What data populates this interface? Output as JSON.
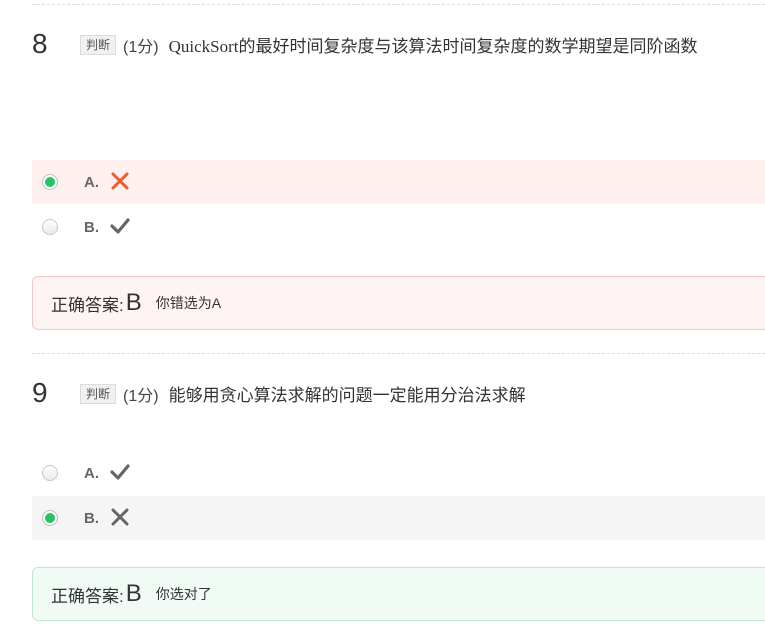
{
  "questions": [
    {
      "number": "8",
      "type": "判断",
      "score": "(1分)",
      "text": "QuickSort的最好时间复杂度与该算法时间复杂度的数学期望是同阶函数",
      "options": [
        {
          "letter": "A.",
          "mark": "cross-icon",
          "mark_color": "#f05a2a",
          "selected": true
        },
        {
          "letter": "B.",
          "mark": "check-icon",
          "mark_color": "#666666",
          "selected": false
        }
      ],
      "answer": {
        "label": "正确答案:",
        "correct": "B",
        "note": "你错选为A",
        "status": "wrong"
      }
    },
    {
      "number": "9",
      "type": "判断",
      "score": "(1分)",
      "text": "能够用贪心算法求解的问题一定能用分治法求解",
      "options": [
        {
          "letter": "A.",
          "mark": "check-icon",
          "mark_color": "#666666",
          "selected": false
        },
        {
          "letter": "B.",
          "mark": "cross-icon",
          "mark_color": "#666666",
          "selected": true
        }
      ],
      "answer": {
        "label": "正确答案:",
        "correct": "B",
        "note": "你选对了",
        "status": "right"
      }
    }
  ],
  "colors": {
    "selected_radio": "#22c55e",
    "wrong_bg": "#fff0f0",
    "right_bg": "#f1fbf6",
    "cross_orange": "#f05a2a"
  }
}
